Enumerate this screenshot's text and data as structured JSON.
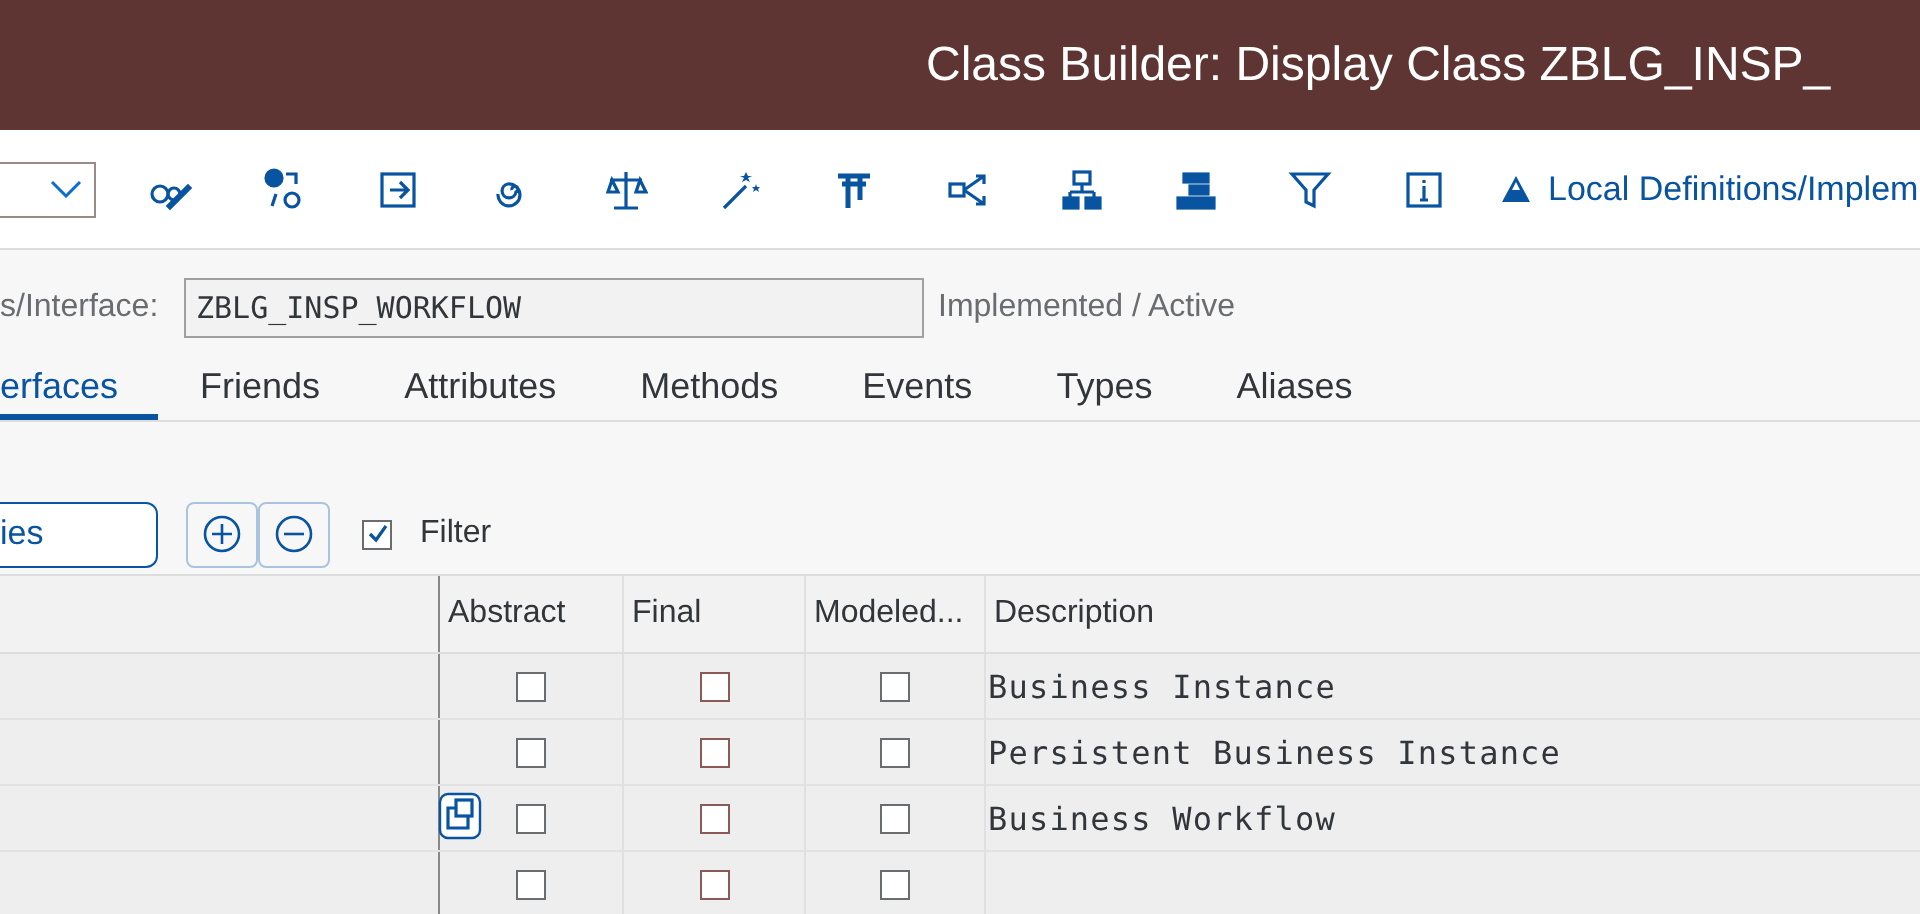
{
  "window": {
    "title": "Class Builder: Display Class ZBLG_INSP_"
  },
  "toolbar": {
    "link": "Local Definitions/Implem"
  },
  "header": {
    "label": "s/Interface:",
    "value": "ZBLG_INSP_WORKFLOW",
    "status": "Implemented / Active"
  },
  "tabs": [
    {
      "label": "erfaces",
      "selected": true
    },
    {
      "label": "Friends",
      "selected": false
    },
    {
      "label": "Attributes",
      "selected": false
    },
    {
      "label": "Methods",
      "selected": false
    },
    {
      "label": "Events",
      "selected": false
    },
    {
      "label": "Types",
      "selected": false
    },
    {
      "label": "Aliases",
      "selected": false
    }
  ],
  "filter_bar": {
    "field_value": "ies",
    "filter": {
      "label": "Filter",
      "checked": true
    }
  },
  "table": {
    "columns": [
      "Abstract",
      "Final",
      "Modeled...",
      "Description"
    ],
    "rows": [
      {
        "abstract": false,
        "final": false,
        "modeled": false,
        "description": "Business Instance",
        "cursor": false
      },
      {
        "abstract": false,
        "final": false,
        "modeled": false,
        "description": "Persistent Business Instance",
        "cursor": false
      },
      {
        "abstract": false,
        "final": false,
        "modeled": false,
        "description": "Business Workflow",
        "cursor": true
      },
      {
        "abstract": false,
        "final": false,
        "modeled": false,
        "cursor": false
      }
    ]
  }
}
